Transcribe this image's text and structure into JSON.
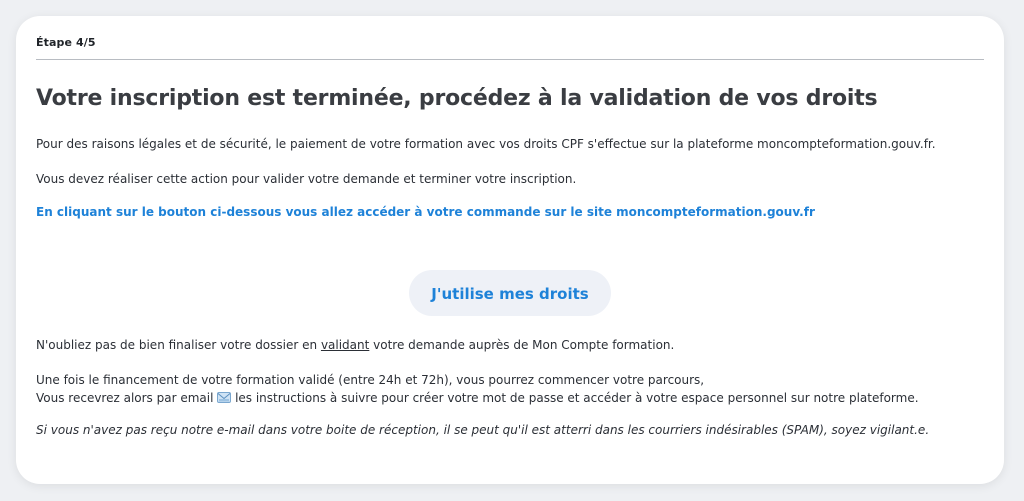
{
  "card": {
    "step_label": "Étape 4/5",
    "title": "Votre inscription est terminée, procédez à la validation de vos droits",
    "paragraph1": "Pour des raisons légales et de sécurité, le paiement de votre formation avec vos droits CPF s'effectue sur la plateforme moncompteformation.gouv.fr.",
    "paragraph2": "Vous devez réaliser cette action pour valider votre demande et terminer votre inscription.",
    "highlight": "En cliquant sur le bouton ci-dessous vous allez accéder à votre commande sur le site moncompteformation.gouv.fr",
    "button_label": "J'utilise mes droits",
    "reminder_before": "N'oubliez pas de bien finaliser votre dossier en ",
    "reminder_link": "validant",
    "reminder_after": " votre demande auprès de Mon Compte formation.",
    "info_line1": "Une fois le financement de votre formation validé (entre 24h et 72h), vous pourrez commencer votre parcours,",
    "info_line2_before": "Vous recevrez alors par email ",
    "info_line2_after": " les instructions à suivre pour créer votre mot de passe et accéder à votre espace personnel sur notre plateforme.",
    "spam_note": "Si vous n'avez pas reçu notre e-mail dans votre boite de réception, il se peut qu'il est atterri dans les courriers indésirables (SPAM), soyez vigilant.e.",
    "mail_icon": "email-envelope-icon"
  },
  "colors": {
    "accent": "#1e82d8",
    "button_bg": "#eef1f7",
    "page_bg": "#eef0f3",
    "card_bg": "#ffffff"
  }
}
